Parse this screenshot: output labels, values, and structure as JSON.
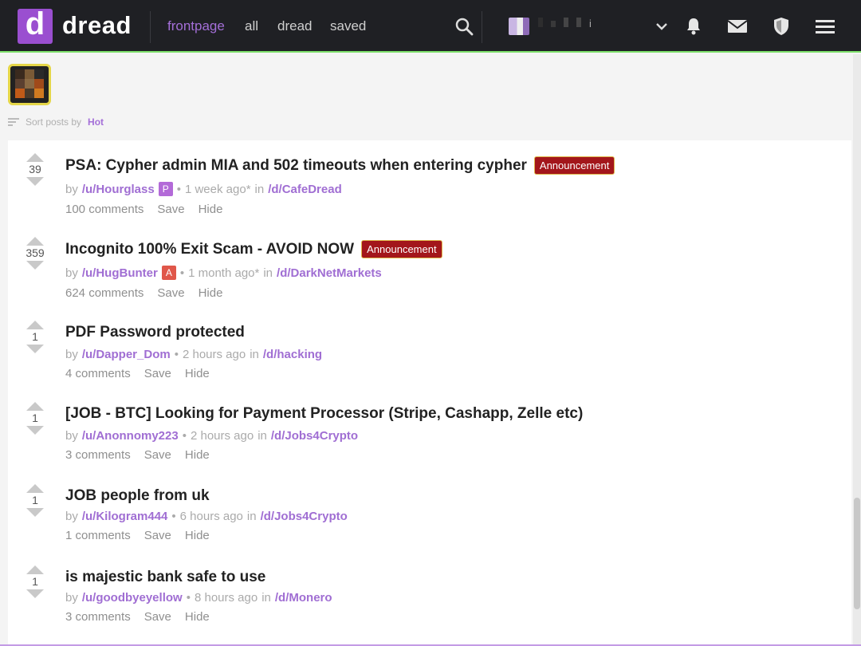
{
  "header": {
    "logo_letter": "d",
    "brand": "dread",
    "nav": [
      "frontpage",
      "all",
      "dread",
      "saved"
    ],
    "active_nav": "frontpage",
    "user_suffix": "i"
  },
  "sort": {
    "label": "Sort posts by",
    "value": "Hot"
  },
  "post_actions": {
    "save": "Save",
    "hide": "Hide"
  },
  "posts": [
    {
      "score": "39",
      "title": "PSA: Cypher admin MIA and 502 timeouts when entering cypher",
      "flair": "Announcement",
      "by": "by",
      "user": "/u/Hourglass",
      "badge": "P",
      "badge_color": "#b36ad8",
      "time": "1 week ago*",
      "in": "in",
      "sub": "/d/CafeDread",
      "comments": "100 comments"
    },
    {
      "score": "359",
      "title": "Incognito 100% Exit Scam - AVOID NOW",
      "flair": "Announcement",
      "by": "by",
      "user": "/u/HugBunter",
      "badge": "A",
      "badge_color": "#e0574a",
      "time": "1 month ago*",
      "in": "in",
      "sub": "/d/DarkNetMarkets",
      "comments": "624 comments"
    },
    {
      "score": "1",
      "title": "PDF Password protected",
      "flair": "",
      "by": "by",
      "user": "/u/Dapper_Dom",
      "badge": "",
      "badge_color": "",
      "time": "2 hours ago",
      "in": "in",
      "sub": "/d/hacking",
      "comments": "4 comments"
    },
    {
      "score": "1",
      "title": "[JOB - BTC] Looking for Payment Processor (Stripe, Cashapp, Zelle etc)",
      "flair": "",
      "by": "by",
      "user": "/u/Anonnomy223",
      "badge": "",
      "badge_color": "",
      "time": "2 hours ago",
      "in": "in",
      "sub": "/d/Jobs4Crypto",
      "comments": "3 comments"
    },
    {
      "score": "1",
      "title": "JOB people from uk",
      "flair": "",
      "by": "by",
      "user": "/u/Kilogram444",
      "badge": "",
      "badge_color": "",
      "time": "6 hours ago",
      "in": "in",
      "sub": "/d/Jobs4Crypto",
      "comments": "1 comments"
    },
    {
      "score": "1",
      "title": "is majestic bank safe to use",
      "flair": "",
      "by": "by",
      "user": "/u/goodbyeyellow",
      "badge": "",
      "badge_color": "",
      "time": "8 hours ago",
      "in": "in",
      "sub": "/d/Monero",
      "comments": "3 comments"
    }
  ],
  "colors": {
    "accent": "#a46fd8",
    "header_bg": "#1f2024",
    "flair_bg": "#a3161b"
  }
}
